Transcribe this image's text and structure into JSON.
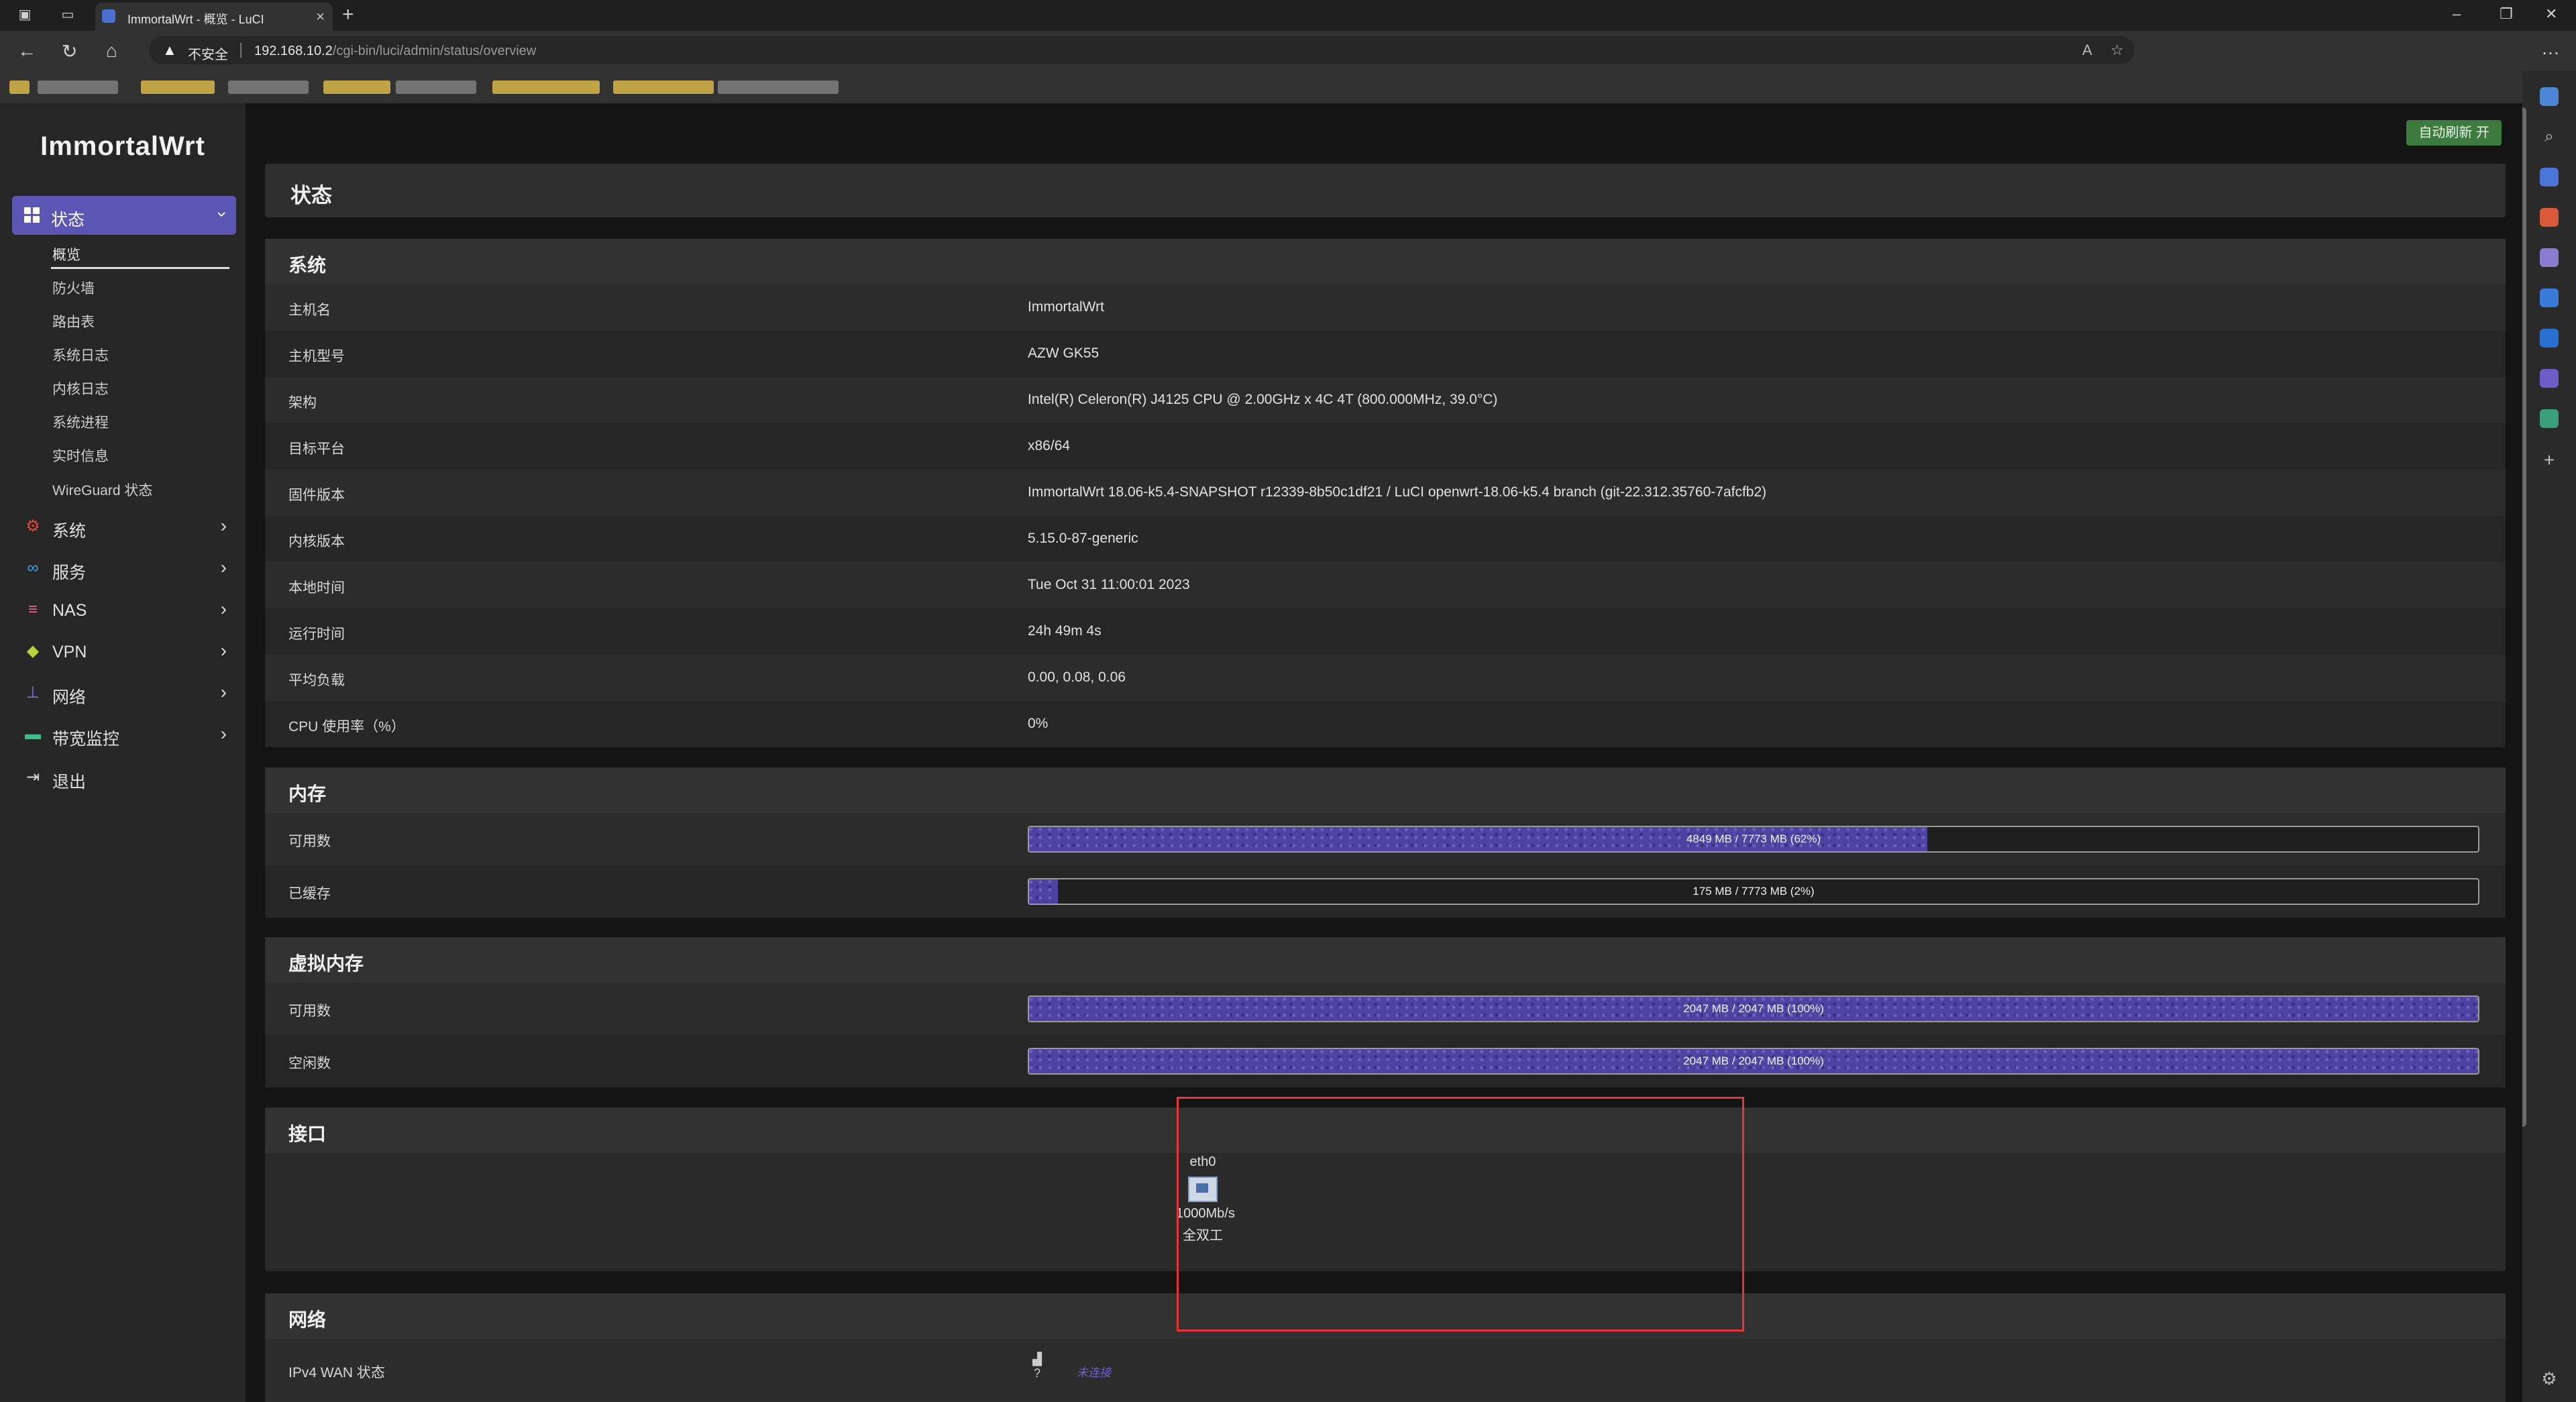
{
  "browser": {
    "tab_title": "ImmortalWrt - 概览 - LuCI",
    "security_label": "不安全",
    "url_host": "192.168.10.2",
    "url_path": "/cgi-bin/luci/admin/status/overview"
  },
  "sidebar": {
    "logo": "ImmortalWrt",
    "active_menu": "状态",
    "sub_items": [
      "概览",
      "防火墙",
      "路由表",
      "系统日志",
      "内核日志",
      "系统进程",
      "实时信息",
      "WireGuard 状态"
    ],
    "menu_items": [
      {
        "label": "系统",
        "icon": "gear-icon",
        "color": "#e24b3b"
      },
      {
        "label": "服务",
        "icon": "link-icon",
        "color": "#3aa0e0"
      },
      {
        "label": "NAS",
        "icon": "database-icon",
        "color": "#e06d82"
      },
      {
        "label": "VPN",
        "icon": "shield-icon",
        "color": "#b5d33a"
      },
      {
        "label": "网络",
        "icon": "network-icon",
        "color": "#8a6ed8"
      },
      {
        "label": "带宽监控",
        "icon": "monitor-icon",
        "color": "#3ac08a"
      },
      {
        "label": "退出",
        "icon": "logout-icon",
        "color": "#dddddd"
      }
    ]
  },
  "content": {
    "auto_refresh": "自动刷新 开",
    "page_title": "状态",
    "system": {
      "title": "系统",
      "rows": [
        {
          "k": "主机名",
          "v": "ImmortalWrt"
        },
        {
          "k": "主机型号",
          "v": "AZW GK55"
        },
        {
          "k": "架构",
          "v": "Intel(R) Celeron(R) J4125 CPU @ 2.00GHz x 4C 4T (800.000MHz, 39.0°C)"
        },
        {
          "k": "目标平台",
          "v": "x86/64"
        },
        {
          "k": "固件版本",
          "v": "ImmortalWrt 18.06-k5.4-SNAPSHOT r12339-8b50c1df21 / LuCI openwrt-18.06-k5.4 branch (git-22.312.35760-7afcfb2)"
        },
        {
          "k": "内核版本",
          "v": "5.15.0-87-generic"
        },
        {
          "k": "本地时间",
          "v": "Tue Oct 31 11:00:01 2023"
        },
        {
          "k": "运行时间",
          "v": "24h 49m 4s"
        },
        {
          "k": "平均负载",
          "v": "0.00, 0.08, 0.06"
        },
        {
          "k": "CPU 使用率（%）",
          "v": "0%"
        }
      ]
    },
    "memory": {
      "title": "内存",
      "rows": [
        {
          "k": "可用数",
          "text": "4849 MB / 7773 MB (62%)",
          "pct": 0.62
        },
        {
          "k": "已缓存",
          "text": "175 MB / 7773 MB (2%)",
          "pct": 0.02
        }
      ]
    },
    "swap": {
      "title": "虚拟内存",
      "rows": [
        {
          "k": "可用数",
          "text": "2047 MB / 2047 MB (100%)",
          "pct": 1.0
        },
        {
          "k": "空闲数",
          "text": "2047 MB / 2047 MB (100%)",
          "pct": 1.0
        }
      ]
    },
    "interfaces": {
      "title": "接口",
      "name": "eth0",
      "speed": "1000Mb/s",
      "duplex": "全双工"
    },
    "network": {
      "title": "网络",
      "wan_label": "IPv4 WAN 状态",
      "wan_icon_text": "?",
      "wan_status": "未连接"
    }
  }
}
